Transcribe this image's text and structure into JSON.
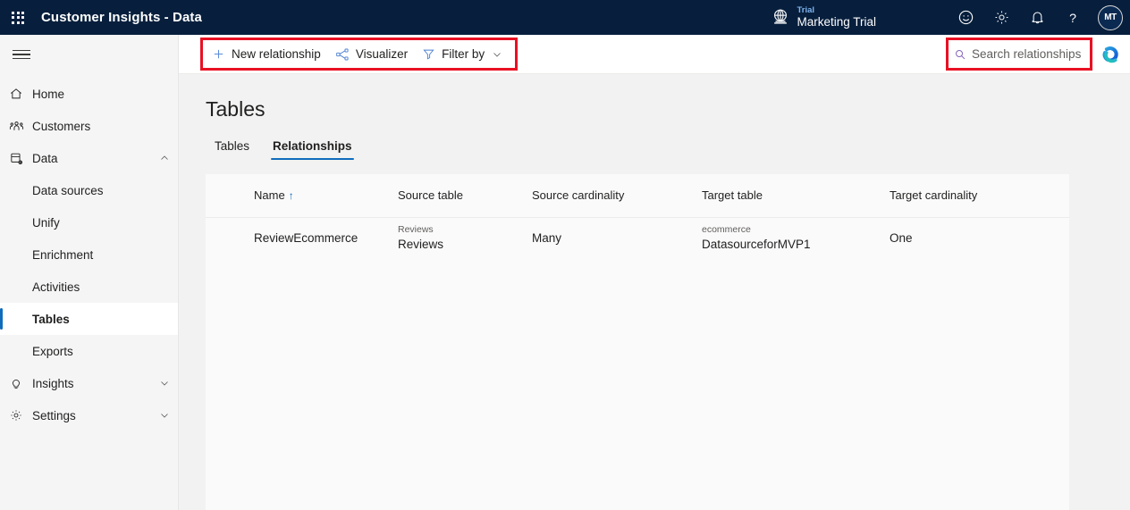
{
  "header": {
    "waffle_icon": "app-launcher-icon",
    "title": "Customer Insights - Data",
    "trial": {
      "icon": "globe-icon",
      "label": "Trial",
      "name": "Marketing Trial"
    },
    "icons": [
      {
        "name": "smiley-feedback-icon",
        "glyph": "smiley"
      },
      {
        "name": "settings-gear-icon",
        "glyph": "gear"
      },
      {
        "name": "notifications-bell-icon",
        "glyph": "bell"
      },
      {
        "name": "help-question-icon",
        "glyph": "question"
      }
    ],
    "avatar_initials": "MT",
    "background_color": "#071F3D"
  },
  "sidebar": {
    "hamburger_icon": "hamburger-menu-icon",
    "items": [
      {
        "label": "Home",
        "icon": "home-icon",
        "level": "top",
        "active": false,
        "expandable": false
      },
      {
        "label": "Customers",
        "icon": "people-icon",
        "level": "top",
        "active": false,
        "expandable": false
      },
      {
        "label": "Data",
        "icon": "database-gear-icon",
        "level": "top",
        "active": false,
        "expandable": true,
        "expanded": true
      },
      {
        "label": "Data sources",
        "icon": "",
        "level": "sub",
        "active": false,
        "expandable": false
      },
      {
        "label": "Unify",
        "icon": "",
        "level": "sub",
        "active": false,
        "expandable": false
      },
      {
        "label": "Enrichment",
        "icon": "",
        "level": "sub",
        "active": false,
        "expandable": false
      },
      {
        "label": "Activities",
        "icon": "",
        "level": "sub",
        "active": false,
        "expandable": false
      },
      {
        "label": "Tables",
        "icon": "",
        "level": "sub",
        "active": true,
        "expandable": false
      },
      {
        "label": "Exports",
        "icon": "",
        "level": "sub",
        "active": false,
        "expandable": false
      },
      {
        "label": "Insights",
        "icon": "lightbulb-icon",
        "level": "top",
        "active": false,
        "expandable": true,
        "expanded": false
      },
      {
        "label": "Settings",
        "icon": "gear-icon",
        "level": "top",
        "active": false,
        "expandable": true,
        "expanded": false
      }
    ],
    "accent_color": "#0f6cbd"
  },
  "commandbar": {
    "highlight_color": "#e81123",
    "buttons": [
      {
        "label": "New relationship",
        "icon": "plus-icon",
        "chevron": false
      },
      {
        "label": "Visualizer",
        "icon": "share-nodes-icon",
        "chevron": false
      },
      {
        "label": "Filter by",
        "icon": "filter-funnel-icon",
        "chevron": true
      }
    ],
    "search": {
      "icon": "search-icon",
      "placeholder": "Search relationships",
      "value": ""
    },
    "copilot_icon": "copilot-icon"
  },
  "main": {
    "page_title": "Tables",
    "tabs": [
      {
        "label": "Tables",
        "active": false
      },
      {
        "label": "Relationships",
        "active": true
      }
    ],
    "table": {
      "columns": [
        {
          "label": "Name",
          "sorted": true,
          "sort_arrow": "↑"
        },
        {
          "label": "Source table",
          "sorted": false,
          "sort_arrow": ""
        },
        {
          "label": "Source cardinality",
          "sorted": false,
          "sort_arrow": ""
        },
        {
          "label": "Target table",
          "sorted": false,
          "sort_arrow": ""
        },
        {
          "label": "Target cardinality",
          "sorted": false,
          "sort_arrow": ""
        }
      ],
      "rows": [
        {
          "name": "ReviewEcommerce",
          "source_table_sub": "Reviews",
          "source_table_main": "Reviews",
          "source_cardinality": "Many",
          "target_table_sub": "ecommerce",
          "target_table_main": "DatasourceforMVP1",
          "target_cardinality": "One"
        }
      ]
    }
  }
}
